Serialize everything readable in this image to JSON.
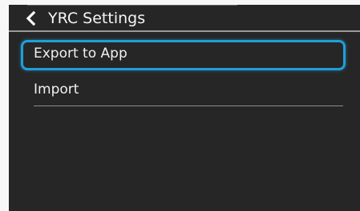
{
  "header": {
    "back_icon": "chevron-left-icon",
    "title": "YRC Settings"
  },
  "menu": {
    "items": [
      {
        "label": "Export to App",
        "selected": true
      },
      {
        "label": "Import",
        "selected": false
      }
    ]
  },
  "colors": {
    "background": "#262626",
    "selection_border": "#1f9fd8",
    "text": "#f0f0f0"
  }
}
